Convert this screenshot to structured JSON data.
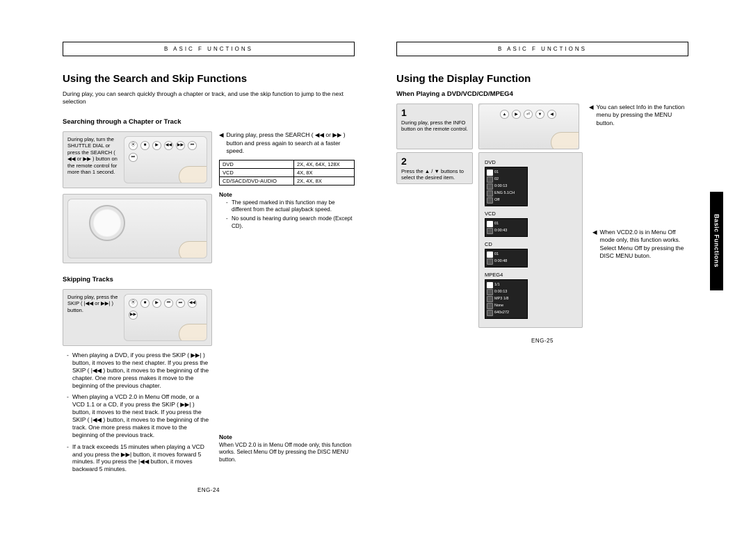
{
  "header": "B ASIC  F UNCTIONS",
  "sidetab": "Basic Functions",
  "left": {
    "title": "Using the Search and Skip Functions",
    "intro": "During play, you can search quickly through a chapter or track, and use the skip function to jump to the next selection",
    "sec1": {
      "h": "Searching through a Chapter or Track",
      "greytxt": "During play, turn the SHUTTLE DIAL or press the SEARCH ( ◀◀ or ▶▶ ) button on the remote control for more than 1 second.",
      "ptr": "During play, press the SEARCH ( ◀◀ or ▶▶ ) button and press again to search at a faster speed.",
      "tbl": [
        [
          "DVD",
          "2X, 4X, 64X, 128X"
        ],
        [
          "VCD",
          "4X, 8X"
        ],
        [
          "CD/SACD/DVD-AUDIO",
          "2X, 4X, 8X"
        ]
      ],
      "noteh": "Note",
      "notes": [
        "The speed marked in this function may be different from the actual playback speed.",
        "No sound is hearing during search mode (Except CD)."
      ]
    },
    "sec2": {
      "h": "Skipping Tracks",
      "greytxt": "During play, press the SKIP ( |◀◀ or ▶▶| ) button.",
      "dash": [
        "When playing a DVD, if you press the SKIP ( ▶▶| ) button, it moves to the next chapter. If you press the SKIP ( |◀◀ ) button, it moves to the beginning of the chapter. One more press makes it move to the beginning of the previous chapter.",
        "When playing a VCD 2.0 in Menu Off mode, or a VCD 1.1 or a CD, if you press the SKIP ( ▶▶| ) button, it moves to the next track. If you press the SKIP ( |◀◀ ) button, it moves to the beginning of the track. One more press makes it move to the beginning of the previous track.",
        "If a track exceeds 15 minutes when playing a VCD and you press the  ▶▶|  button, it moves forward 5 minutes. If you press the  |◀◀  button, it moves backward 5 minutes."
      ],
      "noteh": "Note",
      "note": "When VCD 2.0 is in Menu Off mode only, this function works. Select Menu Off by pressing the DISC MENU button."
    },
    "pg": "ENG-24"
  },
  "right": {
    "title": "Using the Display Function",
    "sub": "When Playing a DVD/VCD/CD/MPEG4",
    "step1": {
      "num": "1",
      "txt": "During play, press the INFO button on the remote control."
    },
    "r1note": "You can select Info in the function menu by pressing the MENU button.",
    "step2": {
      "num": "2",
      "txt": "Press the ▲ / ▼ buttons to select the desired item."
    },
    "screens": {
      "dvd": {
        "label": "DVD",
        "rows": [
          "01",
          "02",
          "0:00:13",
          "ENG 5.1CH",
          "Off"
        ]
      },
      "vcd": {
        "label": "VCD",
        "rows": [
          "01",
          "0:00:43"
        ]
      },
      "cd": {
        "label": "CD",
        "rows": [
          "01",
          "0:00:48"
        ]
      },
      "mpeg4": {
        "label": "MPEG4",
        "rows": [
          "1/1",
          "0:00:13",
          "MP3 1/8",
          "None",
          "640x272"
        ]
      }
    },
    "r2note": "When VCD2.0 is in Menu Off mode only, this function works. Select Menu Off by pressing the DISC MENU buton.",
    "pg": "ENG-25"
  }
}
